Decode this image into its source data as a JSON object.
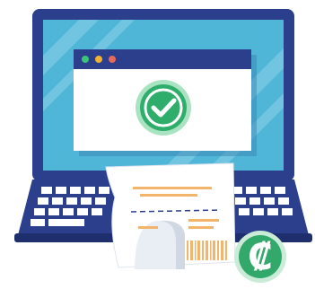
{
  "colors": {
    "screen_frame": "#2b3f8c",
    "screen_bg": "#4fb6d7",
    "screen_stripe": "#8fd3ea",
    "window_bar": "#2b3f8c",
    "window_body": "#ffffff",
    "dot_green": "#3cc47a",
    "dot_yellow": "#f2b233",
    "dot_red": "#e86a5a",
    "check_green": "#2fae6b",
    "check_ring": "#a9e3c2",
    "keyboard_base": "#2b3f8c",
    "keys": "#ffffff",
    "receipt": "#ffffff",
    "receipt_lines": "#f2b56b",
    "currency_badge": "#32a86a"
  },
  "icons": {
    "window_dots": [
      "green-dot-icon",
      "yellow-dot-icon",
      "red-dot-icon"
    ],
    "status": "checkmark-icon",
    "currency": "colon-currency-icon",
    "barcode": "barcode-icon"
  },
  "badge": {
    "symbol": "₡"
  }
}
